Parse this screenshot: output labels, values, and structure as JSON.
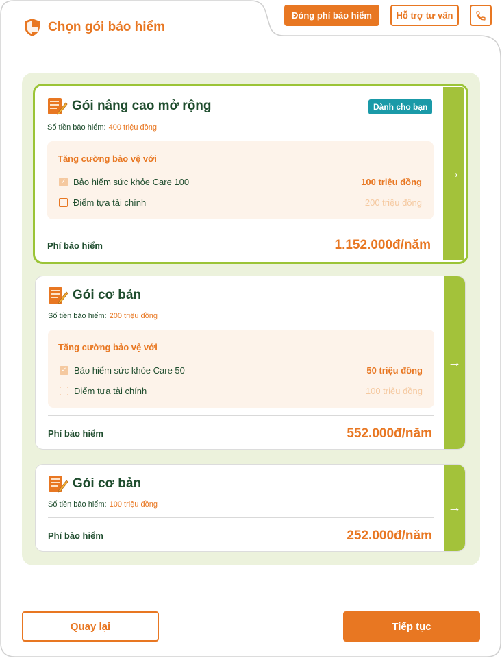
{
  "header": {
    "title": "Chọn gói bảo hiểm",
    "pay_button": "Đóng phí bảo hiểm",
    "support_button": "Hỗ trợ tư vấn",
    "phone_icon": "phone-icon"
  },
  "colors": {
    "accent": "#e87722",
    "green_bar": "#a3c23a",
    "panel_bg": "#ecf2dc",
    "badge": "#1a9aa8",
    "title_green": "#1f4d2e"
  },
  "packages": [
    {
      "name": "Gói nâng cao mở rộng",
      "badge": "Dành cho bạn",
      "sum_label": "Số tiền bảo hiểm:",
      "sum_value": "400 triệu đồng",
      "boost_title": "Tăng cường bảo vệ với",
      "options": [
        {
          "label": "Bảo hiểm sức khỏe Care 100",
          "value": "100 triệu đồng",
          "checked": true
        },
        {
          "label": "Điểm tựa tài chính",
          "value": "200 triệu đồng",
          "checked": false
        }
      ],
      "fee_label": "Phí bảo hiểm",
      "fee_value": "1.152.000đ/năm",
      "selected": true
    },
    {
      "name": "Gói cơ bản",
      "sum_label": "Số tiền bảo hiểm:",
      "sum_value": "200 triệu đồng",
      "boost_title": "Tăng cường bảo vệ với",
      "options": [
        {
          "label": "Bảo hiểm sức khỏe Care 50",
          "value": "50 triệu đồng",
          "checked": true
        },
        {
          "label": "Điểm tựa tài chính",
          "value": "100 triệu đồng",
          "checked": false
        }
      ],
      "fee_label": "Phí bảo hiểm",
      "fee_value": "552.000đ/năm",
      "selected": false
    },
    {
      "name": "Gói cơ bản",
      "sum_label": "Số tiền bảo hiểm:",
      "sum_value": "100 triệu đồng",
      "fee_label": "Phí bảo hiểm",
      "fee_value": "252.000đ/năm",
      "selected": false
    }
  ],
  "footer": {
    "back_button": "Quay lại",
    "next_button": "Tiếp tục"
  }
}
